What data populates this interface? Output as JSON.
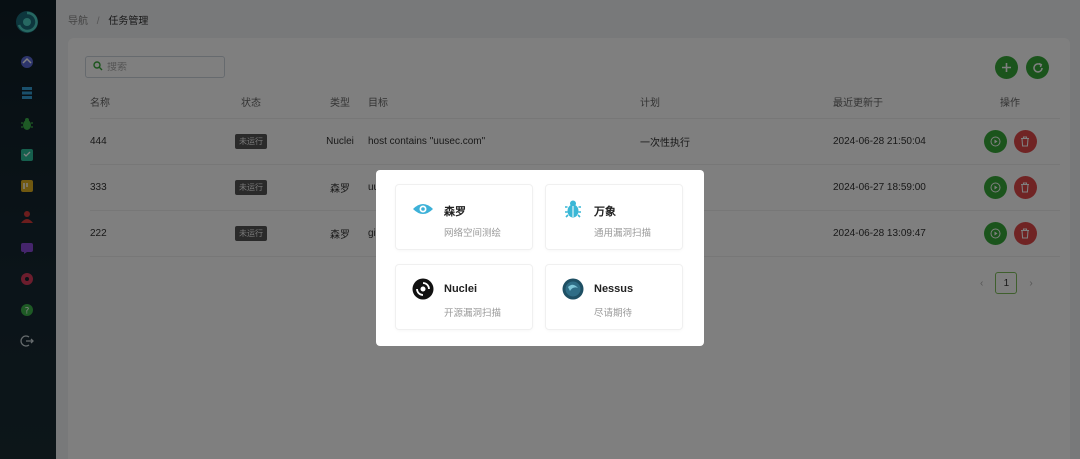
{
  "breadcrumb": {
    "root": "导航",
    "separator": "/",
    "current": "任务管理"
  },
  "search": {
    "placeholder": "搜索"
  },
  "table": {
    "headers": [
      "名称",
      "状态",
      "类型",
      "目标",
      "计划",
      "最近更新于",
      "操作"
    ],
    "rows": [
      {
        "name": "444",
        "status": "未运行",
        "type": "Nuclei",
        "target": "host contains \"uusec.com\"",
        "plan": "一次性执行",
        "updated": "2024-06-28 21:50:04"
      },
      {
        "name": "333",
        "status": "未运行",
        "type": "森罗",
        "target": "uu",
        "plan": "",
        "updated": "2024-06-27 18:59:00"
      },
      {
        "name": "222",
        "status": "未运行",
        "type": "森罗",
        "target": "git",
        "plan": "",
        "updated": "2024-06-28 13:09:47"
      }
    ]
  },
  "pagination": {
    "prev": "‹",
    "current": "1",
    "next": "›"
  },
  "modal": {
    "tiles": [
      {
        "name": "森罗",
        "desc": "网络空间测绘",
        "icon": "eye-icon",
        "color": "#3db1d8"
      },
      {
        "name": "万象",
        "desc": "通用漏洞扫描",
        "icon": "bug-icon",
        "color": "#3ab7d6"
      },
      {
        "name": "Nuclei",
        "desc": "开源漏洞扫描",
        "icon": "nuclei-logo-icon",
        "color": "#111111"
      },
      {
        "name": "Nessus",
        "desc": "尽请期待",
        "icon": "nessus-logo-icon",
        "color": "#2f6d86"
      }
    ]
  },
  "sidebar": {
    "icons": [
      {
        "name": "dashboard-icon",
        "color": "#5a6bd8"
      },
      {
        "name": "database-icon",
        "color": "#35a0d8"
      },
      {
        "name": "bug-icon",
        "color": "#3cb44a"
      },
      {
        "name": "report-icon",
        "color": "#2cbf9a"
      },
      {
        "name": "task-icon",
        "color": "#e0b020"
      },
      {
        "name": "user-icon",
        "color": "#d83a3a"
      },
      {
        "name": "message-icon",
        "color": "#8a4ad8"
      },
      {
        "name": "settings-icon",
        "color": "#d83a5a"
      },
      {
        "name": "help-icon",
        "color": "#3cb44a"
      },
      {
        "name": "logout-icon",
        "color": "#cfd8dc"
      }
    ]
  },
  "colors": {
    "primary": "#36a839",
    "danger": "#e04848",
    "sidebar": "#13242c"
  }
}
